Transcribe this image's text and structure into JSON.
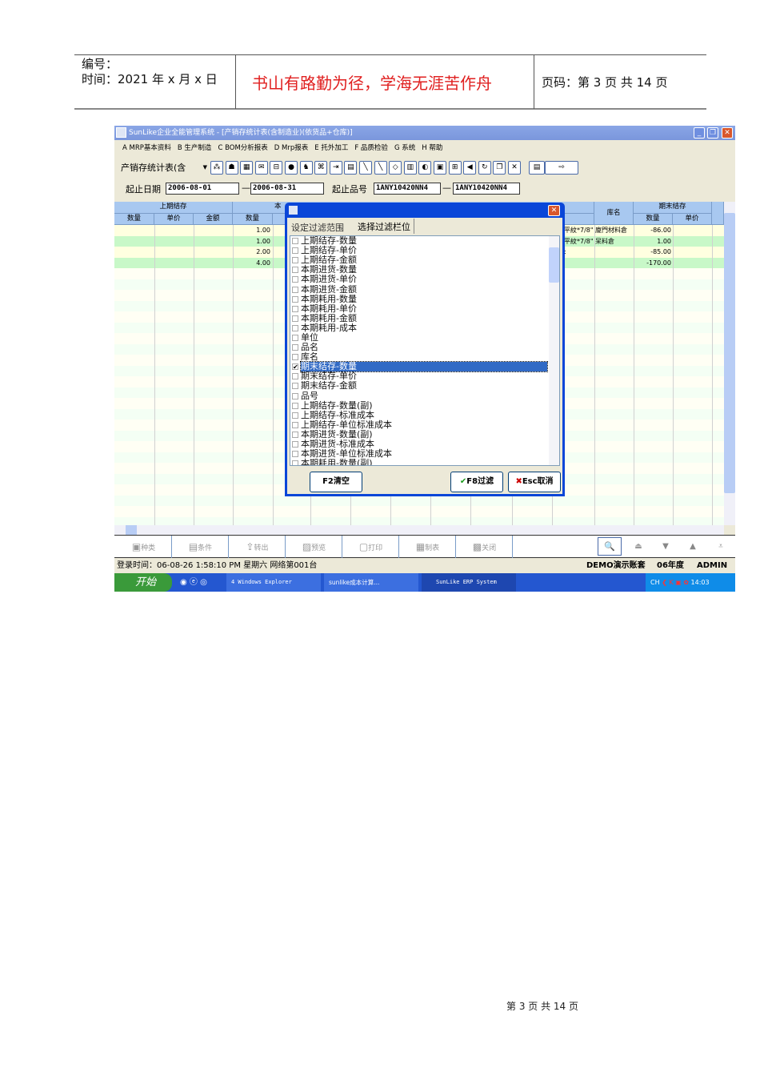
{
  "doc_header": {
    "number_label": "编号：",
    "time_label": "时间：2021 年 x 月 x 日",
    "motto": "书山有路勤为径，学海无涯苦作舟",
    "page_label": "页码：第 3 页  共 14 页"
  },
  "window": {
    "title": "SunLike企业全能管理系统 - [产销存统计表(含制造业)(依货品+仓库)]",
    "menu": [
      "A MRP基本资料",
      "B 生产制造",
      "C BOM分析报表",
      "D Mrp报表",
      "E 托外加工",
      "F 品质检验",
      "G 系统",
      "H 帮助"
    ],
    "report_select": "产销存统计表(含",
    "filters": {
      "date_label": "起止日期",
      "date_from": "2006-08-01",
      "date_to": "2006-08-31",
      "item_label": "起止品号",
      "item_from": "1ANY10420NN4",
      "item_to": "1ANY10420NN4"
    },
    "grid": {
      "group_prev": "上期结存",
      "group_cur": "本",
      "group_end": "期末结存",
      "col_qty": "数量",
      "col_price": "单价",
      "col_amount": "金额",
      "col_warehouse": "库名",
      "rows": [
        {
          "qty": "1.00",
          "name": "平紋*7/8\"",
          "warehouse": "廈門材料倉",
          "end_qty": "-86.00"
        },
        {
          "qty": "1.00",
          "name": "平紋*7/8\"",
          "warehouse": "呆料倉",
          "end_qty": "1.00"
        },
        {
          "qty": "2.00",
          "name": ":",
          "warehouse": "",
          "end_qty": "-85.00"
        },
        {
          "qty": "4.00",
          "name": "",
          "warehouse": "",
          "end_qty": "-170.00"
        }
      ]
    },
    "bottom_toolbar": [
      "种类",
      "条件",
      "转出",
      "预览",
      "打印",
      "制表",
      "关闭"
    ],
    "status": {
      "login": "登录时间：06-08-26 1:58:10 PM  星期六   网络第001台",
      "account": "DEMO演示账套",
      "year": "06年度",
      "user": "ADMIN"
    },
    "taskbar": {
      "start": "开始",
      "items": [
        "4 Windows Explorer",
        "sunlike成本计算...",
        "SunLike ERP System"
      ],
      "lang": "CH",
      "clock": "14:03"
    }
  },
  "dialog": {
    "tabs": [
      "设定过滤范围",
      "选择过滤栏位"
    ],
    "fields": [
      {
        "label": "上期结存-数量",
        "checked": false
      },
      {
        "label": "上期结存-单价",
        "checked": false
      },
      {
        "label": "上期结存-金额",
        "checked": false
      },
      {
        "label": "本期进货-数量",
        "checked": false
      },
      {
        "label": "本期进货-单价",
        "checked": false
      },
      {
        "label": "本期进货-金额",
        "checked": false
      },
      {
        "label": "本期耗用-数量",
        "checked": false
      },
      {
        "label": "本期耗用-单价",
        "checked": false
      },
      {
        "label": "本期耗用-金额",
        "checked": false
      },
      {
        "label": "本期耗用-成本",
        "checked": false
      },
      {
        "label": "单位",
        "checked": false
      },
      {
        "label": "品名",
        "checked": false
      },
      {
        "label": "库名",
        "checked": false
      },
      {
        "label": "期末结存-数量",
        "checked": true
      },
      {
        "label": "期末结存-单价",
        "checked": false
      },
      {
        "label": "期末结存-金额",
        "checked": false
      },
      {
        "label": "品号",
        "checked": false
      },
      {
        "label": "上期结存-数量(副)",
        "checked": false
      },
      {
        "label": "上期结存-标准成本",
        "checked": false
      },
      {
        "label": "上期结存-单位标准成本",
        "checked": false
      },
      {
        "label": "本期进货-数量(副)",
        "checked": false
      },
      {
        "label": "本期进货-标准成本",
        "checked": false
      },
      {
        "label": "本期进货-单位标准成本",
        "checked": false
      },
      {
        "label": "本期耗用-数量(副)",
        "checked": false
      }
    ],
    "clear": "F2清空",
    "filter": "F8过滤",
    "cancel": "Esc取消"
  },
  "footer": "第  3  页  共  14  页"
}
